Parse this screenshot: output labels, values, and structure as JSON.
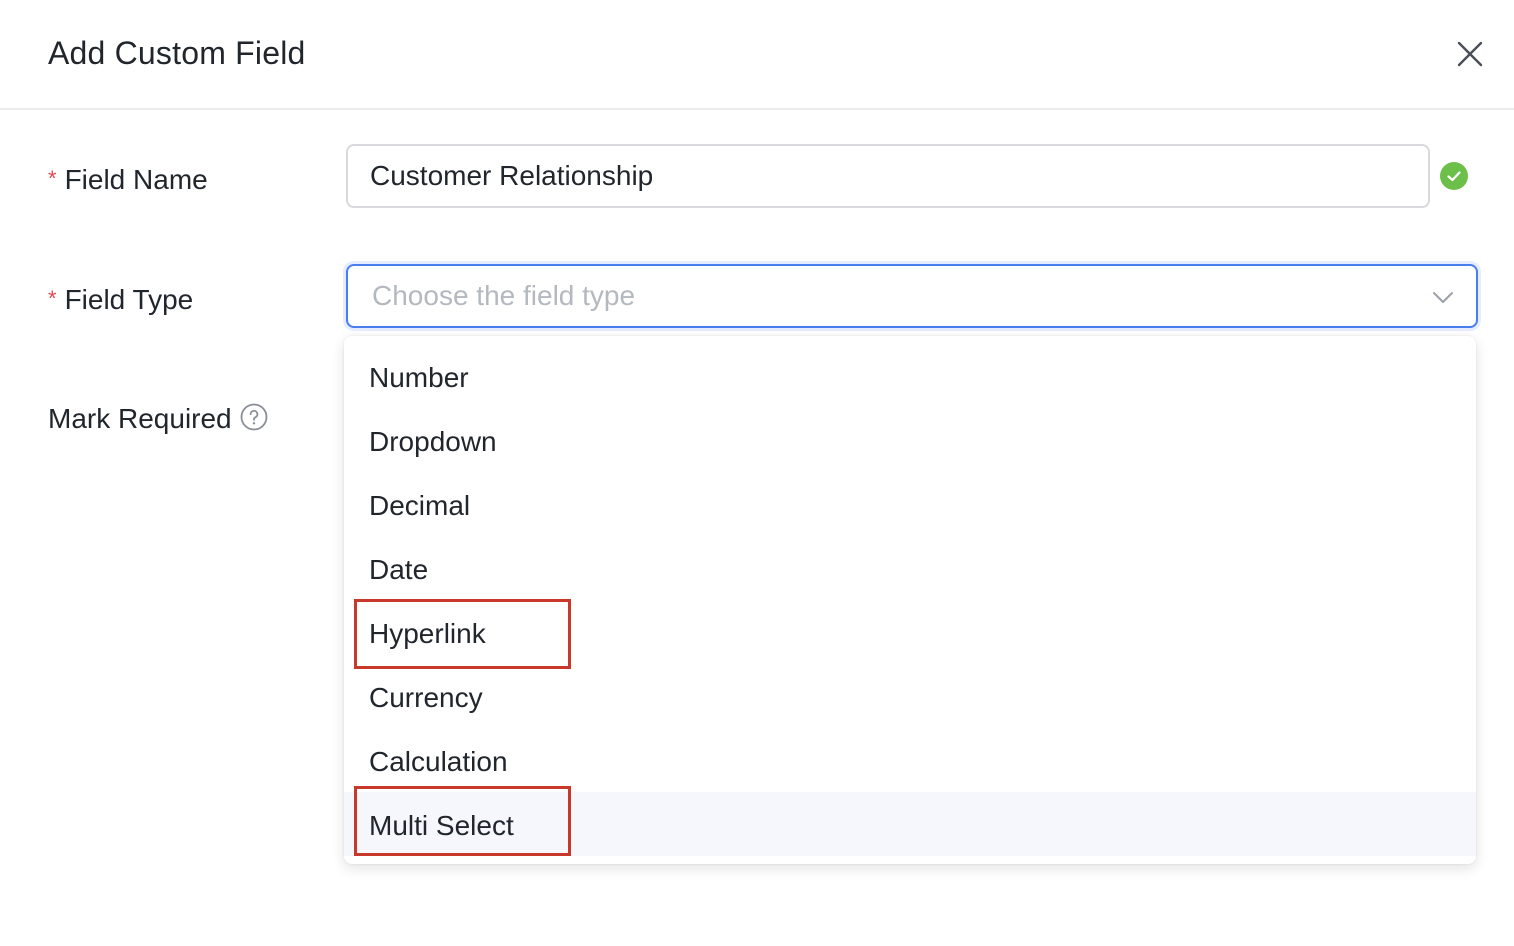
{
  "dialog": {
    "title": "Add Custom Field",
    "close_icon": "close-icon"
  },
  "form": {
    "field_name": {
      "label": "Field Name",
      "required_marker": "*",
      "value": "Customer Relationship",
      "status_icon": "check-circle-icon",
      "status_color": "#6cc04a"
    },
    "field_type": {
      "label": "Field Type",
      "required_marker": "*",
      "placeholder": "Choose the field type",
      "icon": "chevron-down-icon",
      "focus_color": "#4a7df0"
    },
    "mark_required": {
      "label": "Mark Required",
      "icon": "help-circle-icon"
    }
  },
  "dropdown": {
    "options": [
      {
        "label": "Number"
      },
      {
        "label": "Dropdown"
      },
      {
        "label": "Decimal"
      },
      {
        "label": "Date"
      },
      {
        "label": "Hyperlink",
        "annotated": true
      },
      {
        "label": "Currency"
      },
      {
        "label": "Calculation"
      },
      {
        "label": "Multi Select",
        "annotated": true,
        "hovered": true
      }
    ],
    "annotation_color": "#c8392b"
  }
}
